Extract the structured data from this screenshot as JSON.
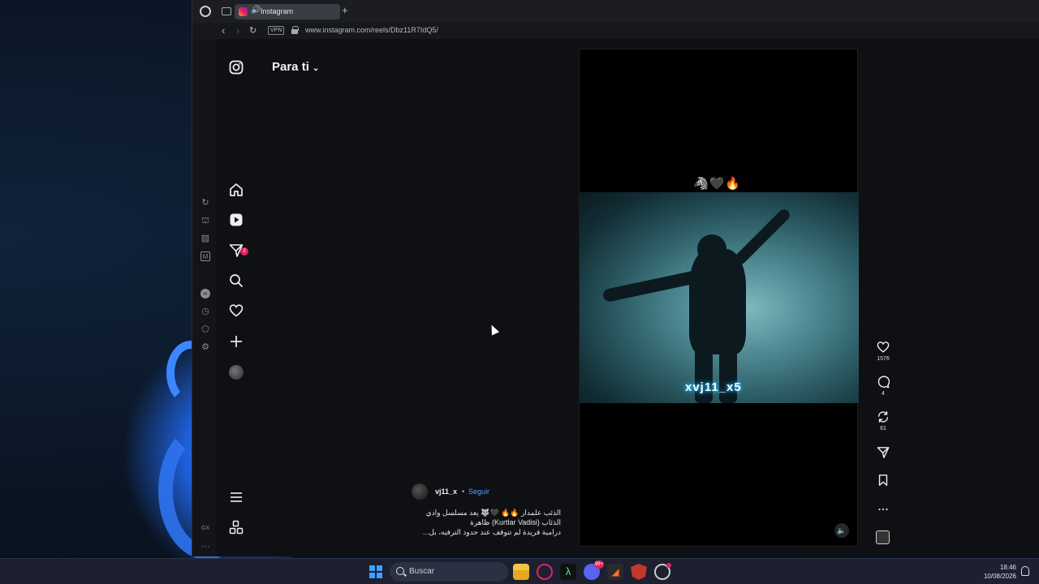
{
  "browser": {
    "tab_title": "Instagram",
    "new_tab": "+",
    "back": "‹",
    "forward": "›",
    "reload": "↻",
    "vpn_label": "VPN",
    "url": "www.instagram.com/reels/Dbz11R7IdQ5/"
  },
  "opera_sidebar": {
    "icons": [
      "aria-icon",
      "crypto-wallet-icon",
      "pinboard-icon",
      "my-flow-icon",
      "spotify-icon",
      "history-icon",
      "extensions-icon",
      "settings-icon",
      "gx-icon",
      "more-icon"
    ],
    "gx_label": "GX",
    "more_label": "···"
  },
  "instagram": {
    "feed_title": "Para ti",
    "notifications_badge": "2",
    "reel": {
      "emoji_caption": "🦓🖤🔥",
      "watermark": "xvj11_x5",
      "username": "vj11_x",
      "separator": "•",
      "follow_label": "Seguir",
      "caption_line1": "الذئب علمدار 🔥🔥 🖤🐺 يعد مسلسل وادي",
      "caption_line2": "الذئاب (Kurtlar Vadisi) ظاهرة",
      "caption_line3": "درامية فريدة لم تتوقف عند حدود الترفيه، بل...",
      "likes": "1576",
      "comments": "4",
      "reposts": "61"
    }
  },
  "taskbar": {
    "search_placeholder": "Buscar",
    "discord_badge": "99+",
    "time": "18:46",
    "date": "10/08/2026"
  },
  "colors": {
    "accent_link": "#4aa3ff",
    "badge_red": "#e0245e",
    "windows_blue": "#3ea0ff"
  }
}
